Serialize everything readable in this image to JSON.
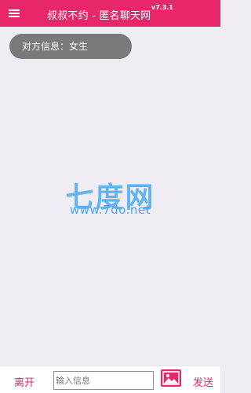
{
  "header": {
    "title": "叔叔不约 - 匿名聊天网",
    "version": "v7.3.1"
  },
  "messages": [
    {
      "text": "对方信息：女生"
    }
  ],
  "watermark": {
    "name": "七度网",
    "url": "www.7do.net"
  },
  "footer": {
    "leave_label": "离开",
    "input_value": "",
    "input_placeholder": "输入信息",
    "send_label": "发送"
  },
  "colors": {
    "accent": "#e8266a",
    "background": "#efedf3",
    "bubble": "#7a7a7a",
    "watermark": "#61b3f1"
  },
  "icons": [
    "menu-icon",
    "image-icon"
  ]
}
